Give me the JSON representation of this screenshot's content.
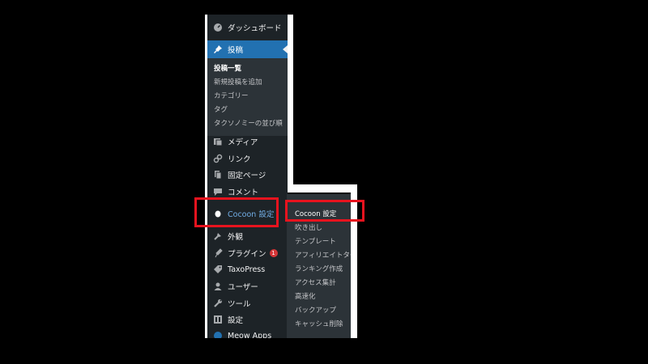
{
  "menu": {
    "dashboard": "ダッシュボード",
    "posts": "投稿",
    "posts_submenu": [
      "投稿一覧",
      "新規投稿を追加",
      "カテゴリー",
      "タグ",
      "タクソノミーの並び順"
    ],
    "media": "メディア",
    "links": "リンク",
    "pages": "固定ページ",
    "comments": "コメント",
    "cocoon": "Cocoon 設定",
    "appearance": "外観",
    "plugins": "プラグイン",
    "plugins_badge": "1",
    "taxopress": "TaxoPress",
    "users": "ユーザー",
    "tools": "ツール",
    "settings": "設定",
    "meow": "Meow Apps"
  },
  "flyout": [
    "Cocoon 設定",
    "吹き出し",
    "テンプレート",
    "アフィリエイトタグ",
    "ランキング作成",
    "アクセス集計",
    "高速化",
    "バックアップ",
    "キャッシュ削除"
  ],
  "colors": {
    "sidebar_bg": "#1d2327",
    "submenu_bg": "#2c3338",
    "active_bg": "#2271b1",
    "highlight_red": "#e8131e"
  }
}
